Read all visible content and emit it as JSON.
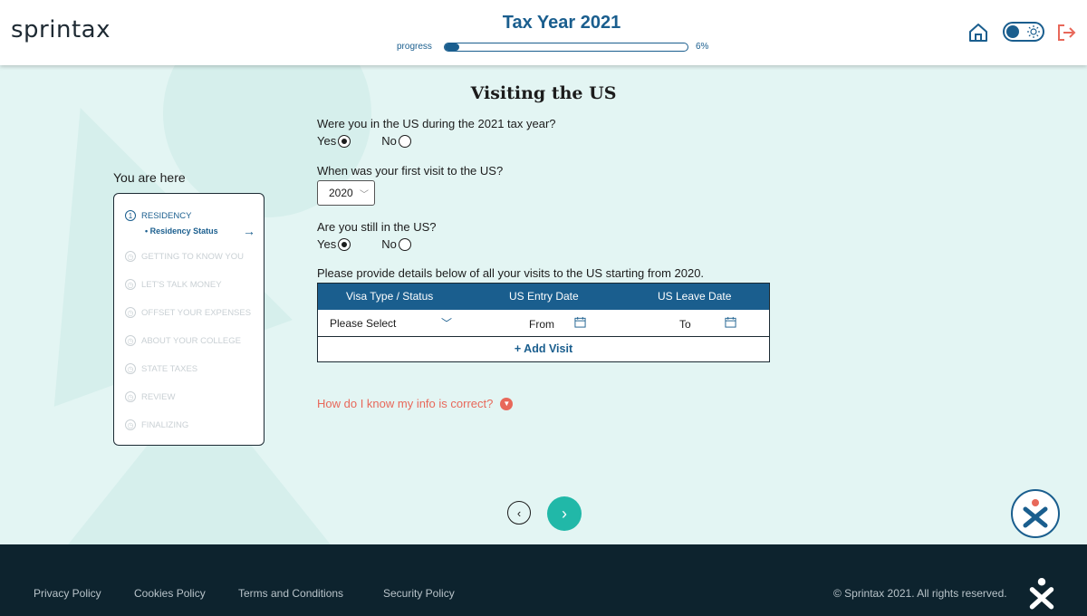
{
  "header": {
    "logo": "sprintax",
    "tax_year_title": "Tax Year 2021",
    "progress_label": "progress",
    "progress_percent_label": "6%",
    "progress_value": 0.06,
    "colors": {
      "brand_blue": "#1a5e8e",
      "accent_red": "#e8685a"
    }
  },
  "page": {
    "title": "Visiting the US"
  },
  "sidebar": {
    "heading": "You are here",
    "steps": [
      {
        "num": "1",
        "label": "RESIDENCY",
        "active": true
      },
      {
        "label": "GETTING TO KNOW YOU"
      },
      {
        "label": "LET'S TALK MONEY"
      },
      {
        "label": "OFFSET YOUR EXPENSES"
      },
      {
        "label": "ABOUT YOUR COLLEGE"
      },
      {
        "label": "STATE TAXES"
      },
      {
        "label": "REVIEW"
      },
      {
        "label": "FINALIZING"
      }
    ],
    "current_substep": "• Residency Status"
  },
  "form": {
    "q1": {
      "text": "Were you in the US during the 2021 tax year?",
      "yes": "Yes",
      "no": "No",
      "selected": "Yes"
    },
    "q2": {
      "text": "When was your first visit to the US?",
      "value": "2020"
    },
    "q3": {
      "text": "Are you still in the US?",
      "yes": "Yes",
      "no": "No",
      "selected": "Yes"
    },
    "visits_intro": "Please provide details below of all your visits to the US starting from 2020.",
    "visits_table": {
      "headers": [
        "Visa Type / Status",
        "US Entry Date",
        "US Leave Date"
      ],
      "row": {
        "visa": "Please Select",
        "from": "From",
        "to": "To"
      },
      "add_label": "+ Add Visit"
    },
    "info_link": "How do I know my info is correct?"
  },
  "footer": {
    "links": [
      "Privacy Policy",
      "Cookies Policy",
      "Terms and Conditions",
      "Security Policy"
    ],
    "copyright": "© Sprintax 2021. All rights reserved."
  }
}
